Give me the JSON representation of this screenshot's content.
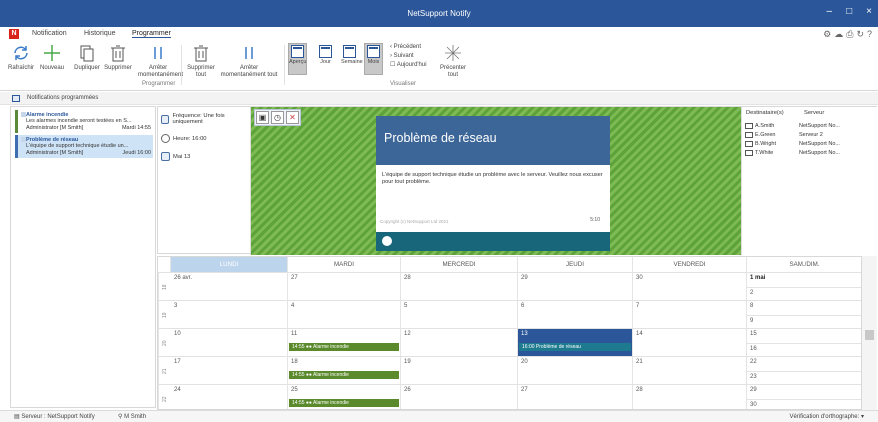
{
  "window": {
    "title": "NetSupport Notify",
    "minimize": "–",
    "maximize": "□",
    "close": "×"
  },
  "menu": {
    "tabs": [
      "Notification",
      "Historique",
      "Programmer"
    ],
    "active": "Programmer",
    "logo": "N"
  },
  "ribbon": {
    "buttons": {
      "refresh": "Rafraîchir",
      "new": "Nouveau",
      "duplicate": "Dupliquer",
      "delete": "Supprimer",
      "pause": "Arrêter momentanément",
      "delete_all": "Supprimer tout",
      "pause_all": "Arrêter momentanément tout",
      "preview": "Aperçu",
      "day": "Jour",
      "week": "Semaine",
      "month": "Mois",
      "previous": "Précédent",
      "next": "Suivant",
      "today": "Aujourd'hui",
      "recenter": "Précenter tout"
    },
    "groups": {
      "schedule": "Programmer",
      "view": "Visualiser"
    }
  },
  "section": {
    "title": "Notifications programmées"
  },
  "notifications": [
    {
      "title": "Alarme incendie",
      "desc": "Les alarmes incendie seront testées en S...",
      "author": "Administrator [M Smith]",
      "when": "Mardi 14:55",
      "selected": false
    },
    {
      "title": "Problème de réseau",
      "desc": "L'équipe de support technique étudie un...",
      "author": "Administrator [M Smith]",
      "when": "Jeudi 16:00",
      "selected": true
    }
  ],
  "detail": {
    "frequency": "Fréquence: Une fois uniquement",
    "time": "Heure: 16:00",
    "date": "Mai 13"
  },
  "preview": {
    "title": "Problème de réseau",
    "body": "L'équipe de support technique étudie un problème avec le serveur. Veuillez nous excuser pour tout problème.",
    "copyright": "Copyright (c) NetSupport Ltd 2021",
    "counter": "5:10"
  },
  "recipients": {
    "headers": [
      "Destinataire(s)",
      "Serveur"
    ],
    "rows": [
      {
        "name": "A.Smith",
        "server": "NetSupport No..."
      },
      {
        "name": "E.Green",
        "server": "Serveur 2"
      },
      {
        "name": "B.Wright",
        "server": "NetSupport No..."
      },
      {
        "name": "T.White",
        "server": "NetSupport No..."
      }
    ]
  },
  "calendar": {
    "days": [
      "LUNDI",
      "MARDI",
      "MERCREDI",
      "JEUDI",
      "VENDREDI",
      "SAM./DIM."
    ],
    "current_day": "LUNDI",
    "weeks": [
      {
        "num": "18",
        "dates": [
          "26 avr.",
          "27",
          "28",
          "29",
          "30"
        ],
        "sat": "1 mai",
        "sun": "2",
        "events": []
      },
      {
        "num": "19",
        "dates": [
          "3",
          "4",
          "5",
          "6",
          "7"
        ],
        "sat": "8",
        "sun": "9",
        "events": []
      },
      {
        "num": "20",
        "dates": [
          "10",
          "11",
          "12",
          "13",
          "14"
        ],
        "sat": "15",
        "sun": "16",
        "events": [
          {
            "day": 1,
            "text": "14:55 ●● Alarme incendie",
            "kind": "alarm"
          },
          {
            "day": 3,
            "text": "16:00  Problème de réseau",
            "kind": "net"
          }
        ],
        "today": 3
      },
      {
        "num": "21",
        "dates": [
          "17",
          "18",
          "19",
          "20",
          "21"
        ],
        "sat": "22",
        "sun": "23",
        "events": [
          {
            "day": 1,
            "text": "14:55 ●● Alarme incendie",
            "kind": "alarm"
          }
        ]
      },
      {
        "num": "22",
        "dates": [
          "24",
          "25",
          "26",
          "27",
          "28"
        ],
        "sat": "29",
        "sun": "30",
        "events": [
          {
            "day": 1,
            "text": "14:55 ●● Alarme incendie",
            "kind": "alarm"
          }
        ]
      }
    ]
  },
  "status": {
    "server": "Serveur : NetSupport Notify",
    "user": "M Smith",
    "spell": "Vérification d'orthographe:"
  }
}
